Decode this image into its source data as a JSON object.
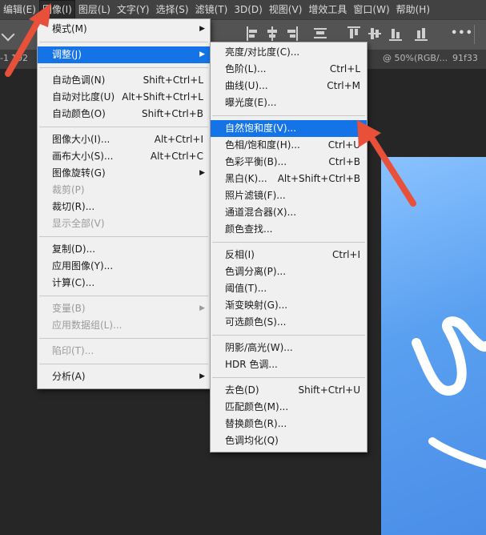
{
  "menubar": {
    "items": [
      {
        "label": "编辑(E)"
      },
      {
        "label": "图像(I)"
      },
      {
        "label": "图层(L)"
      },
      {
        "label": "文字(Y)"
      },
      {
        "label": "选择(S)"
      },
      {
        "label": "滤镜(T)"
      },
      {
        "label": "3D(D)"
      },
      {
        "label": "视图(V)"
      },
      {
        "label": "增效工具"
      },
      {
        "label": "窗口(W)"
      },
      {
        "label": "帮助(H)"
      }
    ]
  },
  "tabs": {
    "t1": "-1",
    "t2": "102",
    "t3": "@ 50%(RGB/...",
    "t4": "91f33",
    "more": "•••"
  },
  "image_menu": {
    "mode": "模式(M)",
    "adjust": "调整(J)",
    "auto_tone": {
      "label": "自动色调(N)",
      "shortcut": "Shift+Ctrl+L"
    },
    "auto_contrast": {
      "label": "自动对比度(U)",
      "shortcut": "Alt+Shift+Ctrl+L"
    },
    "auto_color": {
      "label": "自动颜色(O)",
      "shortcut": "Shift+Ctrl+B"
    },
    "image_size": {
      "label": "图像大小(I)...",
      "shortcut": "Alt+Ctrl+I"
    },
    "canvas_size": {
      "label": "画布大小(S)...",
      "shortcut": "Alt+Ctrl+C"
    },
    "image_rotation": "图像旋转(G)",
    "crop": "裁剪(P)",
    "trim": "裁切(R)...",
    "reveal_all": "显示全部(V)",
    "duplicate": "复制(D)...",
    "apply_image": "应用图像(Y)...",
    "calculations": "计算(C)...",
    "variables": "变量(B)",
    "apply_dataset": "应用数据组(L)...",
    "trap": "陷印(T)...",
    "analysis": "分析(A)"
  },
  "adjust_menu": {
    "brightness_contrast": "亮度/对比度(C)...",
    "levels": {
      "label": "色阶(L)...",
      "shortcut": "Ctrl+L"
    },
    "curves": {
      "label": "曲线(U)...",
      "shortcut": "Ctrl+M"
    },
    "exposure": "曝光度(E)...",
    "vibrance": "自然饱和度(V)...",
    "hue_saturation": {
      "label": "色相/饱和度(H)...",
      "shortcut": "Ctrl+U"
    },
    "color_balance": {
      "label": "色彩平衡(B)...",
      "shortcut": "Ctrl+B"
    },
    "black_white": {
      "label": "黑白(K)...",
      "shortcut": "Alt+Shift+Ctrl+B"
    },
    "photo_filter": "照片滤镜(F)...",
    "channel_mixer": "通道混合器(X)...",
    "color_lookup": "颜色查找...",
    "invert": {
      "label": "反相(I)",
      "shortcut": "Ctrl+I"
    },
    "posterize": "色调分离(P)...",
    "threshold": "阈值(T)...",
    "gradient_map": "渐变映射(G)...",
    "selective_color": "可选颜色(S)...",
    "shadows_highlights": "阴影/高光(W)...",
    "hdr_toning": "HDR 色调...",
    "desaturate": {
      "label": "去色(D)",
      "shortcut": "Shift+Ctrl+U"
    },
    "match_color": "匹配颜色(M)...",
    "replace_color": "替换颜色(R)...",
    "equalize": "色调均化(Q)"
  },
  "colors": {
    "highlight": "#1473e6",
    "annotation_arrow": "#e8503a",
    "canvas": "#5aa0f0"
  }
}
